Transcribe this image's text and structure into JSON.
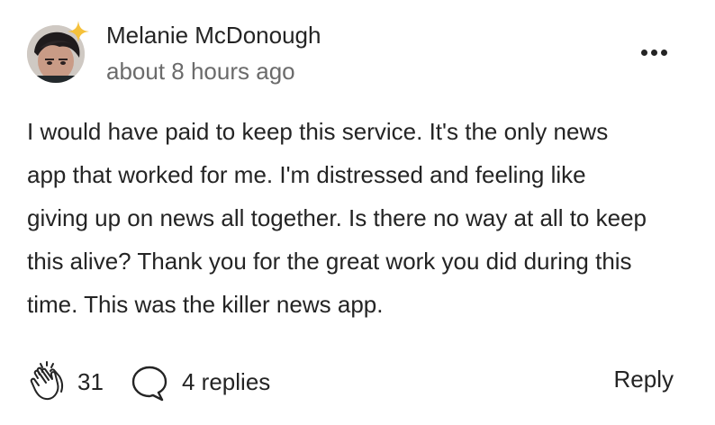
{
  "comment": {
    "author": "Melanie McDonough",
    "timestamp": "about 8 hours ago",
    "body_lines": [
      "I would have paid to keep this service. It's the only news",
      "app that worked for me. I'm distressed and feeling like",
      "giving up on news all together. Is there no way at all to keep",
      "this alive? Thank you for the great work you did during this",
      "time. This was the killer news app."
    ],
    "clap_count": "31",
    "replies_label": "4 replies",
    "reply_label": "Reply",
    "badge_color": "#f5c13b"
  },
  "icons": {
    "more": "more-options-icon",
    "clap": "clap-icon",
    "reply": "speech-bubble-icon",
    "badge": "sparkle-star-icon"
  }
}
